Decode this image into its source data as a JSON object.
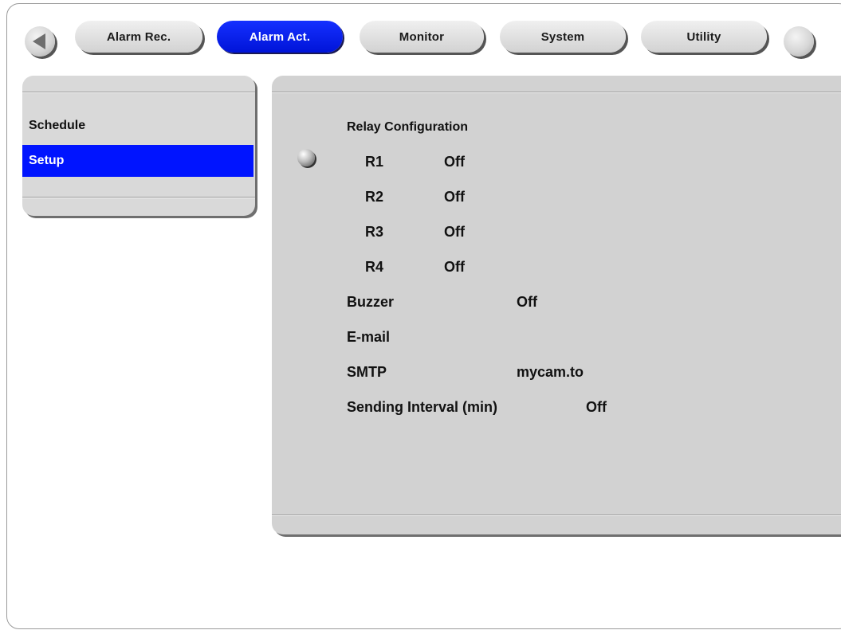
{
  "tabs": [
    {
      "label": "Alarm Rec.",
      "active": false
    },
    {
      "label": "Alarm Act.",
      "active": true
    },
    {
      "label": "Monitor",
      "active": false
    },
    {
      "label": "System",
      "active": false
    },
    {
      "label": "Utility",
      "active": false
    }
  ],
  "nav": {
    "back_icon": "left-arrow-icon",
    "more_icon": "more-icon"
  },
  "sidebar": {
    "items": [
      {
        "label": "Schedule",
        "selected": false
      },
      {
        "label": "Setup",
        "selected": true
      }
    ]
  },
  "relay": {
    "heading": "Relay Configuration",
    "rows": [
      {
        "name": "R1",
        "value": "Off"
      },
      {
        "name": "R2",
        "value": "Off"
      },
      {
        "name": "R3",
        "value": "Off"
      },
      {
        "name": "R4",
        "value": "Off"
      }
    ]
  },
  "buzzer": {
    "label": "Buzzer",
    "value": "Off"
  },
  "email": {
    "label": "E-mail"
  },
  "smtp": {
    "label": "SMTP",
    "value": "mycam.to"
  },
  "interval": {
    "label": "Sending Interval (min)",
    "value": "Off"
  },
  "colors": {
    "accent": "#0014ff",
    "panel": "#d2d2d2",
    "background": "#ffffff"
  }
}
